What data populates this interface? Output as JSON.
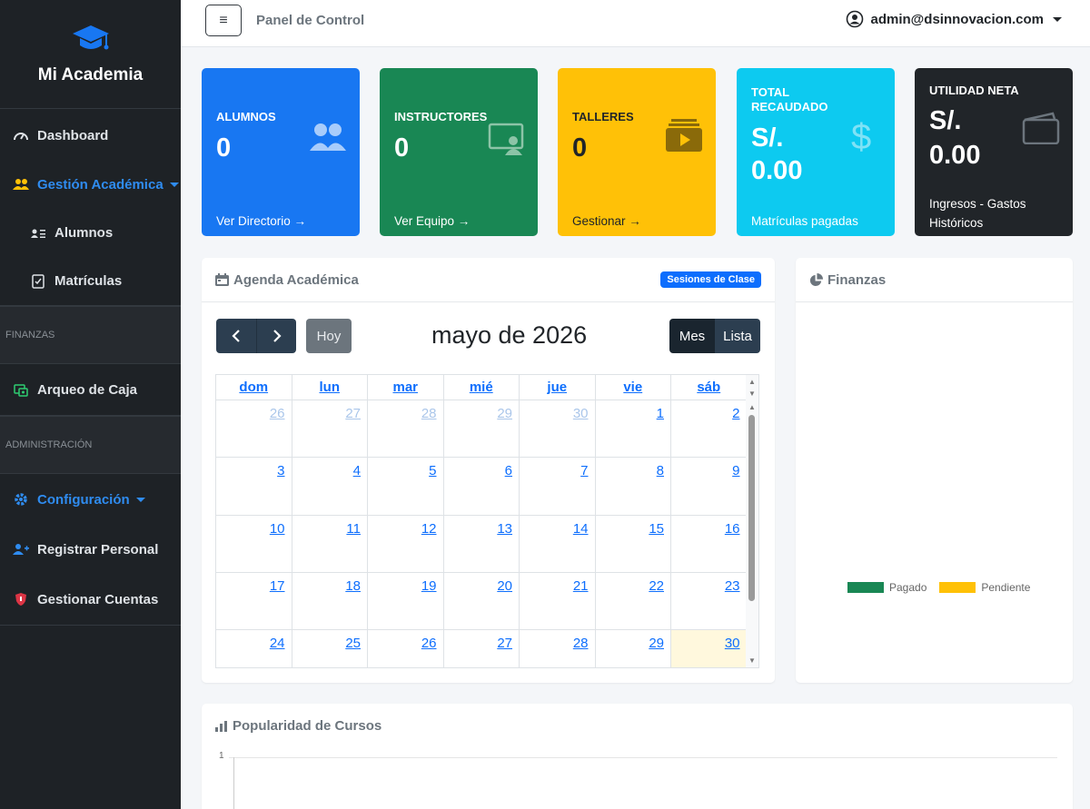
{
  "brand": {
    "name": "Mi Academia"
  },
  "sidebar": {
    "items": [
      {
        "label": "Dashboard",
        "icon": "gauge-icon"
      },
      {
        "label": "Gestión Académica",
        "icon": "users-icon"
      },
      {
        "label": "Alumnos",
        "icon": "id-card-icon"
      },
      {
        "label": "Matrículas",
        "icon": "checklist-icon"
      }
    ],
    "section_finanzas": "FINANZAS",
    "finanzas_items": [
      {
        "label": "Arqueo de Caja",
        "icon": "cash-register-icon"
      }
    ],
    "section_admin": "ADMINISTRACIÓN",
    "admin_items": [
      {
        "label": "Configuración",
        "icon": "gear-icon"
      },
      {
        "label": "Registrar Personal",
        "icon": "user-plus-icon"
      },
      {
        "label": "Gestionar Cuentas",
        "icon": "shield-icon"
      }
    ]
  },
  "topbar": {
    "toggle": "≡",
    "title": "Panel de Control",
    "user": "admin@dsinnovacion.com"
  },
  "cards": [
    {
      "label": "ALUMNOS",
      "value": "0",
      "link": "Ver Directorio →",
      "color": "#1877f2"
    },
    {
      "label": "INSTRUCTORES",
      "value": "0",
      "link": "Ver Equipo →",
      "color": "#198754"
    },
    {
      "label": "TALLERES",
      "value": "0",
      "link": "Gestionar →",
      "color": "#ffc107"
    },
    {
      "label_line1": "TOTAL",
      "label_line2": "RECAUDADO",
      "value_line1": "S/.",
      "value_line2": "0.00",
      "link": "Matrículas pagadas",
      "color": "#0dcaf0"
    },
    {
      "label": "UTILIDAD NETA",
      "value_line1": "S/.",
      "value_line2": "0.00",
      "link_line1": "Ingresos - Gastos",
      "link_line2": "Históricos",
      "color": "#212529"
    }
  ],
  "agenda": {
    "title": "Agenda Académica",
    "badge": "Sesiones de Clase",
    "today_button": "Hoy",
    "month_title": "mayo de 2026",
    "view_month": "Mes",
    "view_list": "Lista",
    "days": [
      "dom",
      "lun",
      "mar",
      "mié",
      "jue",
      "vie",
      "sáb"
    ],
    "weeks": [
      [
        "26",
        "27",
        "28",
        "29",
        "30",
        "1",
        "2"
      ],
      [
        "3",
        "4",
        "5",
        "6",
        "7",
        "8",
        "9"
      ],
      [
        "10",
        "11",
        "12",
        "13",
        "14",
        "15",
        "16"
      ],
      [
        "17",
        "18",
        "19",
        "20",
        "21",
        "22",
        "23"
      ],
      [
        "24",
        "25",
        "26",
        "27",
        "28",
        "29",
        "30"
      ]
    ]
  },
  "finanzas": {
    "title": "Finanzas",
    "legend": [
      {
        "label": "Pagado",
        "color": "#198754"
      },
      {
        "label": "Pendiente",
        "color": "#ffc107"
      }
    ]
  },
  "popularidad": {
    "title": "Popularidad de Cursos",
    "y_tick": "1"
  }
}
